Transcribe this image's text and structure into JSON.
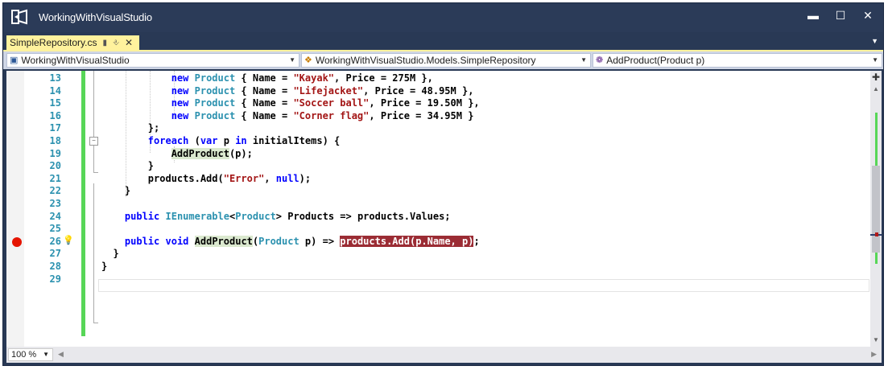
{
  "window": {
    "title": "WorkingWithVisualStudio",
    "logo_icon": "visual-studio-logo-icon",
    "controls": {
      "minimize": "▬",
      "maximize": "☐",
      "close": "✕"
    }
  },
  "tabs": {
    "active_tab": {
      "label": "SimpleRepository.cs",
      "pin_icon": "pin-icon",
      "close_icon": "close-icon"
    },
    "active_color": "#fff29d"
  },
  "navbar": {
    "project": "WorkingWithVisualStudio",
    "type": "WorkingWithVisualStudio.Models.SimpleRepository",
    "member": "AddProduct(Product p)"
  },
  "editor": {
    "line_numbers": [
      "13",
      "14",
      "15",
      "16",
      "17",
      "18",
      "19",
      "20",
      "21",
      "22",
      "23",
      "24",
      "25",
      "26",
      "27",
      "28",
      "29"
    ],
    "breakpoint_line": "26",
    "lightbulb_line": "26",
    "change_bar_color": "#57d657",
    "breakpoint_color": "#e51400",
    "code_lines": [
      [
        {
          "t": "            "
        },
        {
          "t": "new",
          "c": "kw"
        },
        {
          "t": " "
        },
        {
          "t": "Product",
          "c": "ty"
        },
        {
          "t": " { Name = "
        },
        {
          "t": "\"Kayak\"",
          "c": "st"
        },
        {
          "t": ", Price = 275M },"
        }
      ],
      [
        {
          "t": "            "
        },
        {
          "t": "new",
          "c": "kw"
        },
        {
          "t": " "
        },
        {
          "t": "Product",
          "c": "ty"
        },
        {
          "t": " { Name = "
        },
        {
          "t": "\"Lifejacket\"",
          "c": "st"
        },
        {
          "t": ", Price = 48.95M },"
        }
      ],
      [
        {
          "t": "            "
        },
        {
          "t": "new",
          "c": "kw"
        },
        {
          "t": " "
        },
        {
          "t": "Product",
          "c": "ty"
        },
        {
          "t": " { Name = "
        },
        {
          "t": "\"Soccer ball\"",
          "c": "st"
        },
        {
          "t": ", Price = 19.50M },"
        }
      ],
      [
        {
          "t": "            "
        },
        {
          "t": "new",
          "c": "kw"
        },
        {
          "t": " "
        },
        {
          "t": "Product",
          "c": "ty"
        },
        {
          "t": " { Name = "
        },
        {
          "t": "\"Corner flag\"",
          "c": "st"
        },
        {
          "t": ", Price = 34.95M }"
        }
      ],
      [
        {
          "t": "        };"
        }
      ],
      [
        {
          "t": "        "
        },
        {
          "t": "foreach",
          "c": "kw"
        },
        {
          "t": " ("
        },
        {
          "t": "var",
          "c": "kw"
        },
        {
          "t": " p "
        },
        {
          "t": "in",
          "c": "kw"
        },
        {
          "t": " initialItems) {"
        }
      ],
      [
        {
          "t": "            "
        },
        {
          "t": "AddProduct",
          "c": "hl-ref"
        },
        {
          "t": "(p);"
        }
      ],
      [
        {
          "t": "        }"
        }
      ],
      [
        {
          "t": "        products.Add("
        },
        {
          "t": "\"Error\"",
          "c": "st"
        },
        {
          "t": ", "
        },
        {
          "t": "null",
          "c": "kw"
        },
        {
          "t": ");"
        }
      ],
      [
        {
          "t": "    }"
        }
      ],
      [
        {
          "t": ""
        }
      ],
      [
        {
          "t": "    "
        },
        {
          "t": "public",
          "c": "kw"
        },
        {
          "t": " "
        },
        {
          "t": "IEnumerable",
          "c": "ty"
        },
        {
          "t": "<"
        },
        {
          "t": "Product",
          "c": "ty"
        },
        {
          "t": "> Products => products.Values;"
        }
      ],
      [
        {
          "t": ""
        }
      ],
      [
        {
          "t": "    "
        },
        {
          "t": "public",
          "c": "kw"
        },
        {
          "t": " "
        },
        {
          "t": "void",
          "c": "kw"
        },
        {
          "t": " "
        },
        {
          "t": "AddProduct",
          "c": "hl-ref"
        },
        {
          "t": "("
        },
        {
          "t": "Product",
          "c": "ty"
        },
        {
          "t": " p) => "
        },
        {
          "t": "products.Add(p.Name, p)",
          "c": "bp-hl"
        },
        {
          "t": ";"
        }
      ],
      [
        {
          "t": "  }"
        }
      ],
      [
        {
          "t": "}"
        }
      ],
      [
        {
          "t": ""
        }
      ]
    ]
  },
  "statusbar": {
    "zoom": "100 %"
  }
}
